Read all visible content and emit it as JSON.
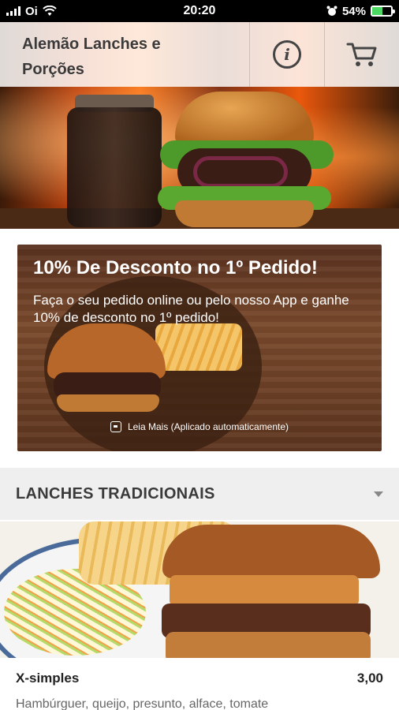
{
  "status_bar": {
    "carrier": "Oi",
    "time": "20:20",
    "battery_percent": "54%",
    "battery_level": 0.54,
    "icons": [
      "signal-icon",
      "wifi-icon",
      "alarm-icon",
      "battery-icon"
    ]
  },
  "header": {
    "title": "Alemão Lanches e Porções",
    "info_icon": "info-icon",
    "cart_icon": "cart-icon"
  },
  "promo": {
    "title": "10% De Desconto no 1º Pedido!",
    "text": "Faça o seu pedido online ou pelo nosso App e ganhe 10% de desconto no 1º pedido!",
    "link_label": "Leia Mais (Aplicado automaticamente)"
  },
  "section": {
    "title": "LANCHES TRADICIONAIS"
  },
  "items": [
    {
      "name": "X-simples",
      "price": "3,00",
      "description": "Hambúrguer, queijo, presunto, alface, tomate"
    }
  ],
  "colors": {
    "status_bar_bg": "#000000",
    "battery_fill": "#4cd964",
    "section_bg": "#efefef"
  }
}
